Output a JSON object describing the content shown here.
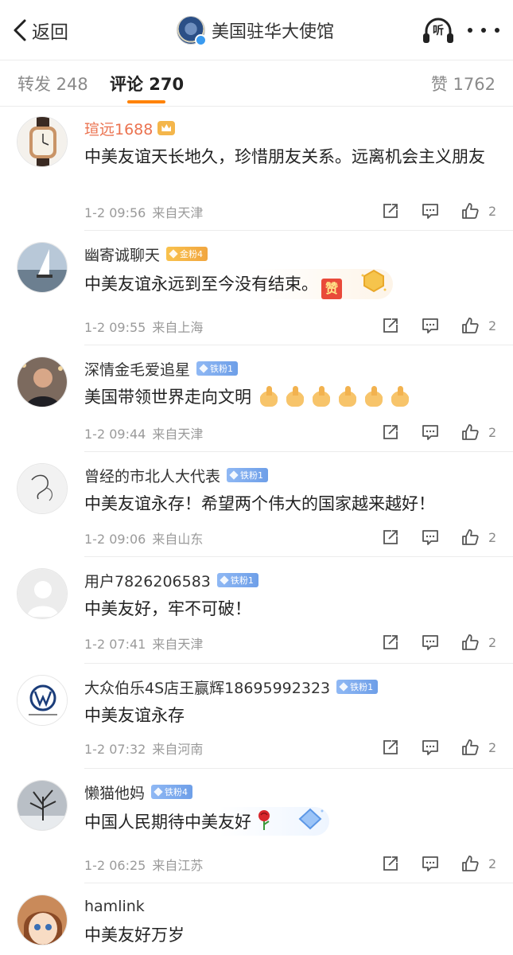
{
  "nav": {
    "back_label": "返回",
    "title": "美国驻华大使馆",
    "listen_label": "听"
  },
  "tabs": {
    "repost": "转发 248",
    "comment": "评论 270",
    "like": "赞 1762"
  },
  "colors": {
    "accent": "#ff8200",
    "vip_name": "#eb7350",
    "fan_gold": "#f5b547",
    "fan_iron": "#7ea9ee"
  },
  "comments": [
    {
      "name": "瑄远1688",
      "badge_icon": "crown-icon",
      "text": "中美友谊天长地久，珍惜朋友关系。远离机会主义朋友",
      "time": "1-2 09:56",
      "location": "来自天津",
      "likes": "2"
    },
    {
      "name": "幽寄诚聊天",
      "fan_badge": "金粉4",
      "text": "中美友谊永远到至今没有结束。",
      "emoji": "赞",
      "time": "1-2 09:55",
      "location": "来自上海",
      "likes": "2"
    },
    {
      "name": "深情金毛爱追星",
      "fan_badge": "铁粉1",
      "text": "美国带领世界走向文明",
      "emoji_icon": "thumbs-up-emoji",
      "time": "1-2 09:44",
      "location": "来自天津",
      "likes": "2"
    },
    {
      "name": "曾经的市北人大代表",
      "fan_badge": "铁粉1",
      "text": "中美友谊永存！希望两个伟大的国家越来越好！",
      "time": "1-2 09:06",
      "location": "来自山东",
      "likes": "2"
    },
    {
      "name": "用户7826206583",
      "fan_badge": "铁粉1",
      "text": "中美友好，牢不可破！",
      "time": "1-2 07:41",
      "location": "来自天津",
      "likes": "2"
    },
    {
      "name": "大众伯乐4S店王赢辉18695992323",
      "fan_badge": "铁粉1",
      "text": "中美友谊永存",
      "time": "1-2 07:32",
      "location": "来自河南",
      "likes": "2"
    },
    {
      "name": "懒猫他妈",
      "fan_badge": "铁粉4",
      "text": "中国人民期待中美友好",
      "emoji_icon": "rose-emoji",
      "time": "1-2 06:25",
      "location": "来自江苏",
      "likes": "2"
    },
    {
      "name": "hamlink",
      "text": "中美友好万岁"
    }
  ]
}
